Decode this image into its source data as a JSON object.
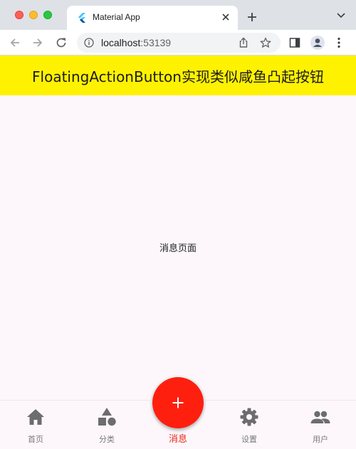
{
  "browser": {
    "tab_title": "Material App",
    "url_host": "localhost",
    "url_port": ":53139"
  },
  "app": {
    "title": "FloatingActionButton实现类似咸鱼凸起按钮",
    "page_text": "消息页面",
    "appbar_color": "#fff200",
    "fab_color": "#ff1f0f",
    "active_color": "#e8271a"
  },
  "bottom_nav": {
    "items": [
      {
        "label": "首页",
        "icon": "home-icon"
      },
      {
        "label": "分类",
        "icon": "category-icon"
      },
      {
        "label": "消息",
        "icon": "message-icon"
      },
      {
        "label": "设置",
        "icon": "gear-icon"
      },
      {
        "label": "用户",
        "icon": "people-icon"
      }
    ],
    "active_index": 2
  }
}
